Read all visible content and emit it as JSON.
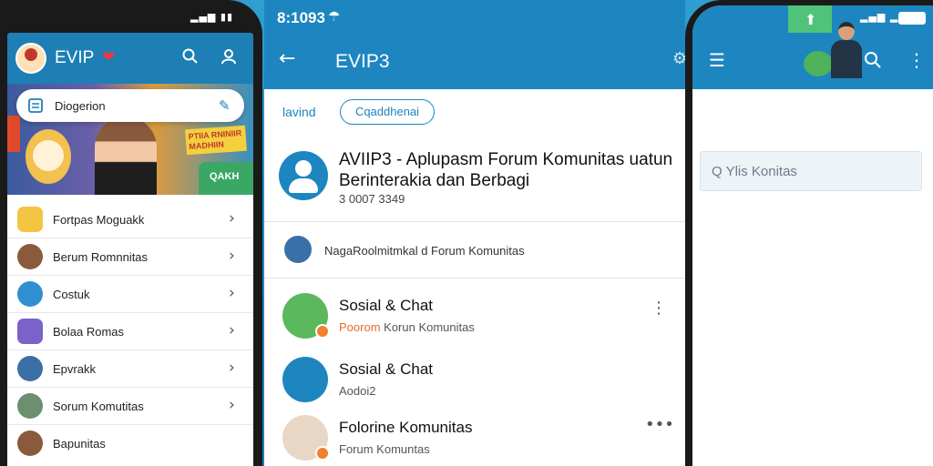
{
  "left_phone": {
    "app_title": "EVIP",
    "search_placeholder": "Diogerion",
    "banner": {
      "tag_text": "PTIIA RNINIIR MADHIIN",
      "corner_text": "QAKH"
    },
    "list": [
      {
        "label": "Fortpas Moguakk",
        "color": "#f4c542"
      },
      {
        "label": "Berum Romnnitas",
        "color": "#8a5a3c"
      },
      {
        "label": "Costuk",
        "color": "#2f8fd1"
      },
      {
        "label": "Bolaa Romas",
        "color": "#7a62c9"
      },
      {
        "label": "Epvrakk",
        "color": "#3a6fa8"
      },
      {
        "label": "Sorum Komutitas",
        "color": "#6b8f6f"
      },
      {
        "label": "Bapunitas",
        "color": "#8a5a3c"
      }
    ]
  },
  "middle": {
    "status_time": "8:1093",
    "title": "EVIP3",
    "tabs": {
      "tab1": "lavind",
      "tab2": "Cqaddhenai"
    },
    "header": {
      "title": "AVIIP3 - Aplupasm Forum Komunitas uatun Berinterakia dan Berbagi",
      "subtitle": "3 0007 3349"
    },
    "info_text": "NagaRoolmitmkal d Forum Komunitas",
    "items": [
      {
        "title": "Sosial & Chat",
        "sub_highlight": "Poorom",
        "sub": " Korun Komunitas",
        "av_color": "#5bb85d"
      },
      {
        "title": "Sosial & Chat",
        "sub_highlight": "",
        "sub": "Aodoi2",
        "av_color": "#1d86c0"
      },
      {
        "title": "Folorine Komunitas",
        "sub_highlight": "",
        "sub": "Forum Komuntas",
        "av_color": "#e9d7c5"
      }
    ]
  },
  "right_phone": {
    "search_placeholder": "Q Ylis Konitas"
  },
  "colors": {
    "primary": "#1d86c0",
    "accent": "#f0822e"
  }
}
